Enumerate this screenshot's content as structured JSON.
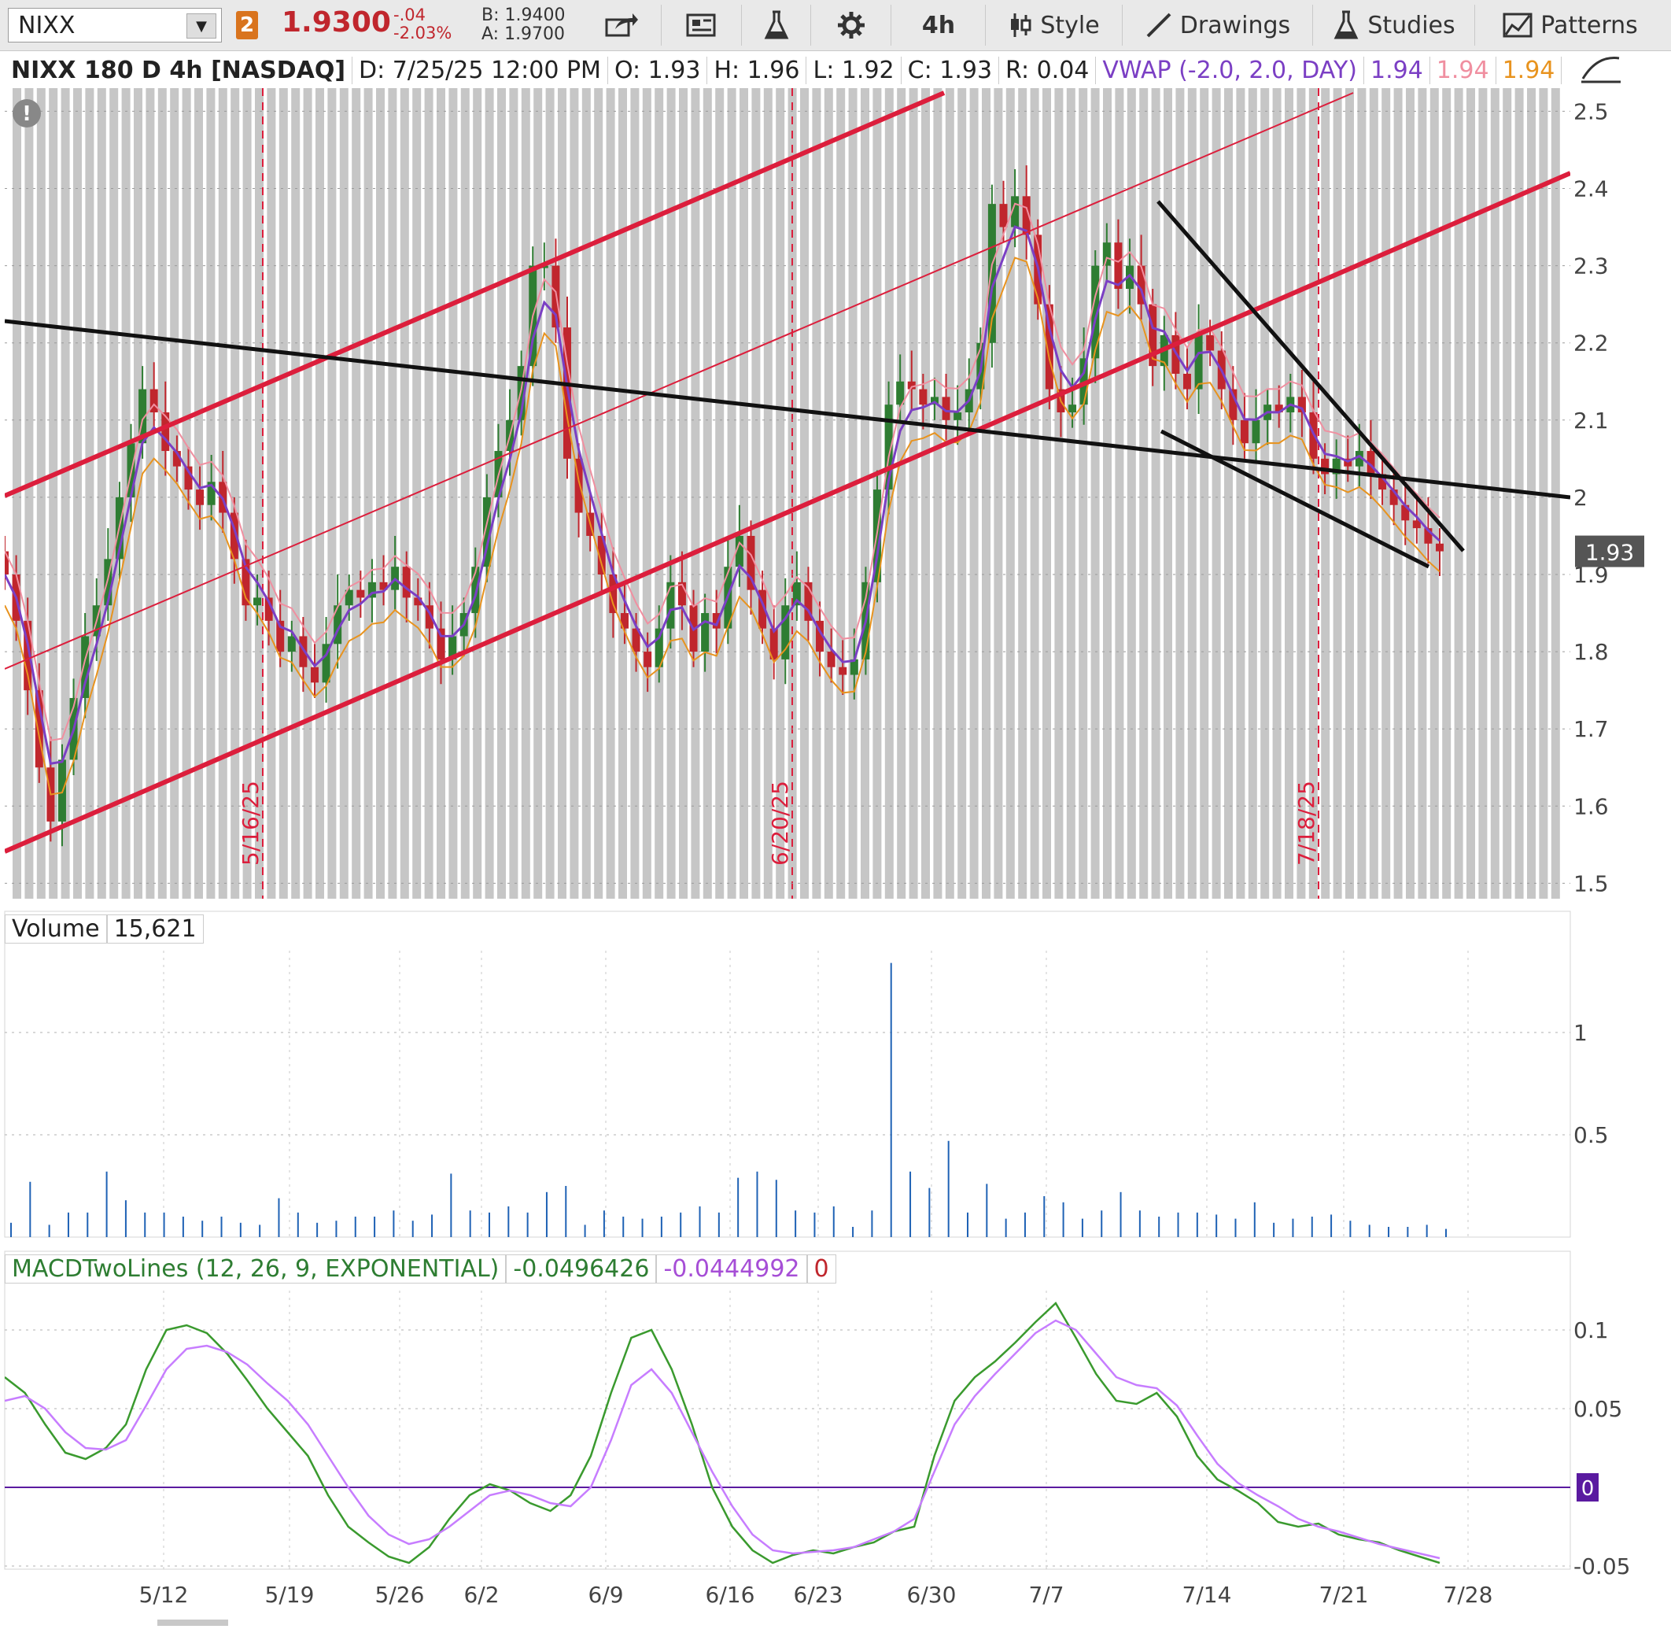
{
  "toolbar": {
    "symbol": "NIXX",
    "badge": "2",
    "last_price": "1.9300",
    "change": "-.04",
    "change_pct": "-2.03%",
    "bid": "B: 1.9400",
    "ask": "A: 1.9700",
    "timeframe": "4h",
    "style_label": "Style",
    "drawings_label": "Drawings",
    "studies_label": "Studies",
    "patterns_label": "Patterns"
  },
  "header": {
    "title": "NIXX 180 D 4h [NASDAQ]",
    "date": "D: 7/25/25 12:00 PM",
    "open": "O: 1.93",
    "high": "H: 1.96",
    "low": "L: 1.92",
    "close": "C: 1.93",
    "range": "R: 0.04",
    "vwap_label": "VWAP (-2.0, 2.0, DAY)",
    "vwap_v1": "1.94",
    "vwap_v2": "1.94",
    "vwap_v3": "1.94",
    "current_price_tag": "1.93"
  },
  "volume_panel": {
    "label": "Volume",
    "value": "15,621"
  },
  "macd_panel": {
    "label": "MACDTwoLines (12, 26, 9, EXPONENTIAL)",
    "value": "-0.0496426",
    "avg": "-0.0444992",
    "diff": "0",
    "zero_tag": "0"
  },
  "colors": {
    "up": "#2e7d32",
    "down": "#c0262d",
    "channel": "#dc1e3c",
    "trend": "#111111",
    "vwap": "#7b3fc4",
    "vwap_band1": "#f08fa0",
    "vwap_band2": "#e8931e",
    "macd": "#3a9a2e",
    "macd_avg": "#c77dff",
    "volume": "#1f62b5"
  },
  "chart_data": [
    {
      "type": "line",
      "title": "",
      "y_ticks": [
        "2.5",
        "2.4",
        "2.3",
        "2.2",
        "2.1",
        "2",
        "1.9",
        "1.8",
        "1.7",
        "1.6",
        "1.5"
      ],
      "ylim": [
        1.48,
        2.53
      ],
      "session_date_labels": [
        "5/16/25",
        "6/20/25",
        "7/18/25"
      ],
      "series": [
        {
          "name": "close",
          "values": [
            1.9,
            1.84,
            1.75,
            1.65,
            1.58,
            1.66,
            1.74,
            1.82,
            1.86,
            1.92,
            2.0,
            2.07,
            2.14,
            2.11,
            2.06,
            2.04,
            2.01,
            1.99,
            2.02,
            1.98,
            1.92,
            1.86,
            1.87,
            1.84,
            1.8,
            1.82,
            1.78,
            1.76,
            1.81,
            1.86,
            1.88,
            1.87,
            1.89,
            1.88,
            1.91,
            1.87,
            1.86,
            1.83,
            1.79,
            1.82,
            1.85,
            1.91,
            2.0,
            2.06,
            2.1,
            2.17,
            2.3,
            2.3,
            2.22,
            2.05,
            1.98,
            1.95,
            1.9,
            1.85,
            1.83,
            1.8,
            1.78,
            1.83,
            1.89,
            1.86,
            1.8,
            1.85,
            1.83,
            1.91,
            1.95,
            1.88,
            1.83,
            1.79,
            1.86,
            1.89,
            1.84,
            1.8,
            1.78,
            1.77,
            1.79,
            1.89,
            2.01,
            2.12,
            2.15,
            2.14,
            2.12,
            2.13,
            2.1,
            2.11,
            2.14,
            2.2,
            2.38,
            2.35,
            2.39,
            2.34,
            2.25,
            2.14,
            2.11,
            2.12,
            2.18,
            2.3,
            2.33,
            2.27,
            2.3,
            2.25,
            2.17,
            2.21,
            2.16,
            2.14,
            2.21,
            2.19,
            2.14,
            2.1,
            2.07,
            2.1,
            2.12,
            2.11,
            2.13,
            2.11,
            2.05,
            2.03,
            2.05,
            2.04,
            2.06,
            2.03,
            2.01,
            1.99,
            1.97,
            1.96,
            1.94,
            1.93
          ]
        }
      ]
    },
    {
      "type": "bar",
      "title": "Volume",
      "y_ticks": [
        "1",
        "0.5"
      ],
      "ylim": [
        0,
        1.4
      ],
      "values": [
        0.07,
        0.27,
        0.06,
        0.12,
        0.12,
        0.32,
        0.18,
        0.12,
        0.12,
        0.1,
        0.08,
        0.1,
        0.07,
        0.06,
        0.19,
        0.12,
        0.07,
        0.08,
        0.1,
        0.1,
        0.13,
        0.08,
        0.11,
        0.31,
        0.13,
        0.12,
        0.15,
        0.12,
        0.22,
        0.25,
        0.06,
        0.13,
        0.1,
        0.09,
        0.1,
        0.12,
        0.15,
        0.12,
        0.29,
        0.32,
        0.28,
        0.13,
        0.12,
        0.15,
        0.05,
        0.13,
        1.34,
        0.32,
        0.24,
        0.47,
        0.12,
        0.26,
        0.09,
        0.12,
        0.2,
        0.17,
        0.09,
        0.13,
        0.22,
        0.13,
        0.1,
        0.12,
        0.12,
        0.11,
        0.09,
        0.17,
        0.07,
        0.09,
        0.1,
        0.11,
        0.08,
        0.06,
        0.05,
        0.05,
        0.06,
        0.04
      ]
    },
    {
      "type": "line",
      "title": "MACDTwoLines (12, 26, 9, EXPONENTIAL)",
      "x_ticks": [
        "5/12",
        "5/19",
        "5/26",
        "6/2",
        "6/9",
        "6/16",
        "6/23",
        "6/30",
        "7/7",
        "7/14",
        "7/21",
        "7/28"
      ],
      "y_ticks": [
        "0.1",
        "0.05",
        "0",
        "-0.05"
      ],
      "ylim": [
        -0.052,
        0.125
      ],
      "series": [
        {
          "name": "Value",
          "values": [
            0.07,
            0.06,
            0.04,
            0.022,
            0.018,
            0.025,
            0.04,
            0.075,
            0.1,
            0.103,
            0.098,
            0.085,
            0.068,
            0.05,
            0.035,
            0.02,
            -0.005,
            -0.025,
            -0.035,
            -0.044,
            -0.048,
            -0.038,
            -0.02,
            -0.005,
            0.002,
            -0.002,
            -0.01,
            -0.015,
            -0.005,
            0.02,
            0.06,
            0.095,
            0.1,
            0.075,
            0.04,
            0.0,
            -0.025,
            -0.04,
            -0.048,
            -0.043,
            -0.04,
            -0.042,
            -0.038,
            -0.035,
            -0.028,
            -0.025,
            0.02,
            0.055,
            0.07,
            0.08,
            0.092,
            0.105,
            0.117,
            0.095,
            0.072,
            0.055,
            0.053,
            0.06,
            0.045,
            0.02,
            0.005,
            -0.002,
            -0.01,
            -0.022,
            -0.025,
            -0.023,
            -0.03,
            -0.033,
            -0.035,
            -0.04,
            -0.044,
            -0.048
          ]
        },
        {
          "name": "Avg",
          "values": [
            0.055,
            0.058,
            0.05,
            0.035,
            0.025,
            0.024,
            0.03,
            0.052,
            0.075,
            0.088,
            0.09,
            0.086,
            0.078,
            0.066,
            0.055,
            0.04,
            0.02,
            0.0,
            -0.018,
            -0.03,
            -0.036,
            -0.033,
            -0.025,
            -0.015,
            -0.005,
            -0.002,
            -0.005,
            -0.01,
            -0.012,
            0.0,
            0.03,
            0.065,
            0.075,
            0.06,
            0.035,
            0.01,
            -0.012,
            -0.03,
            -0.04,
            -0.042,
            -0.041,
            -0.04,
            -0.038,
            -0.033,
            -0.028,
            -0.02,
            0.01,
            0.04,
            0.058,
            0.072,
            0.085,
            0.098,
            0.106,
            0.1,
            0.085,
            0.07,
            0.065,
            0.063,
            0.052,
            0.033,
            0.015,
            0.003,
            -0.005,
            -0.012,
            -0.02,
            -0.025,
            -0.028,
            -0.032,
            -0.036,
            -0.039,
            -0.042,
            -0.045
          ]
        }
      ]
    }
  ]
}
